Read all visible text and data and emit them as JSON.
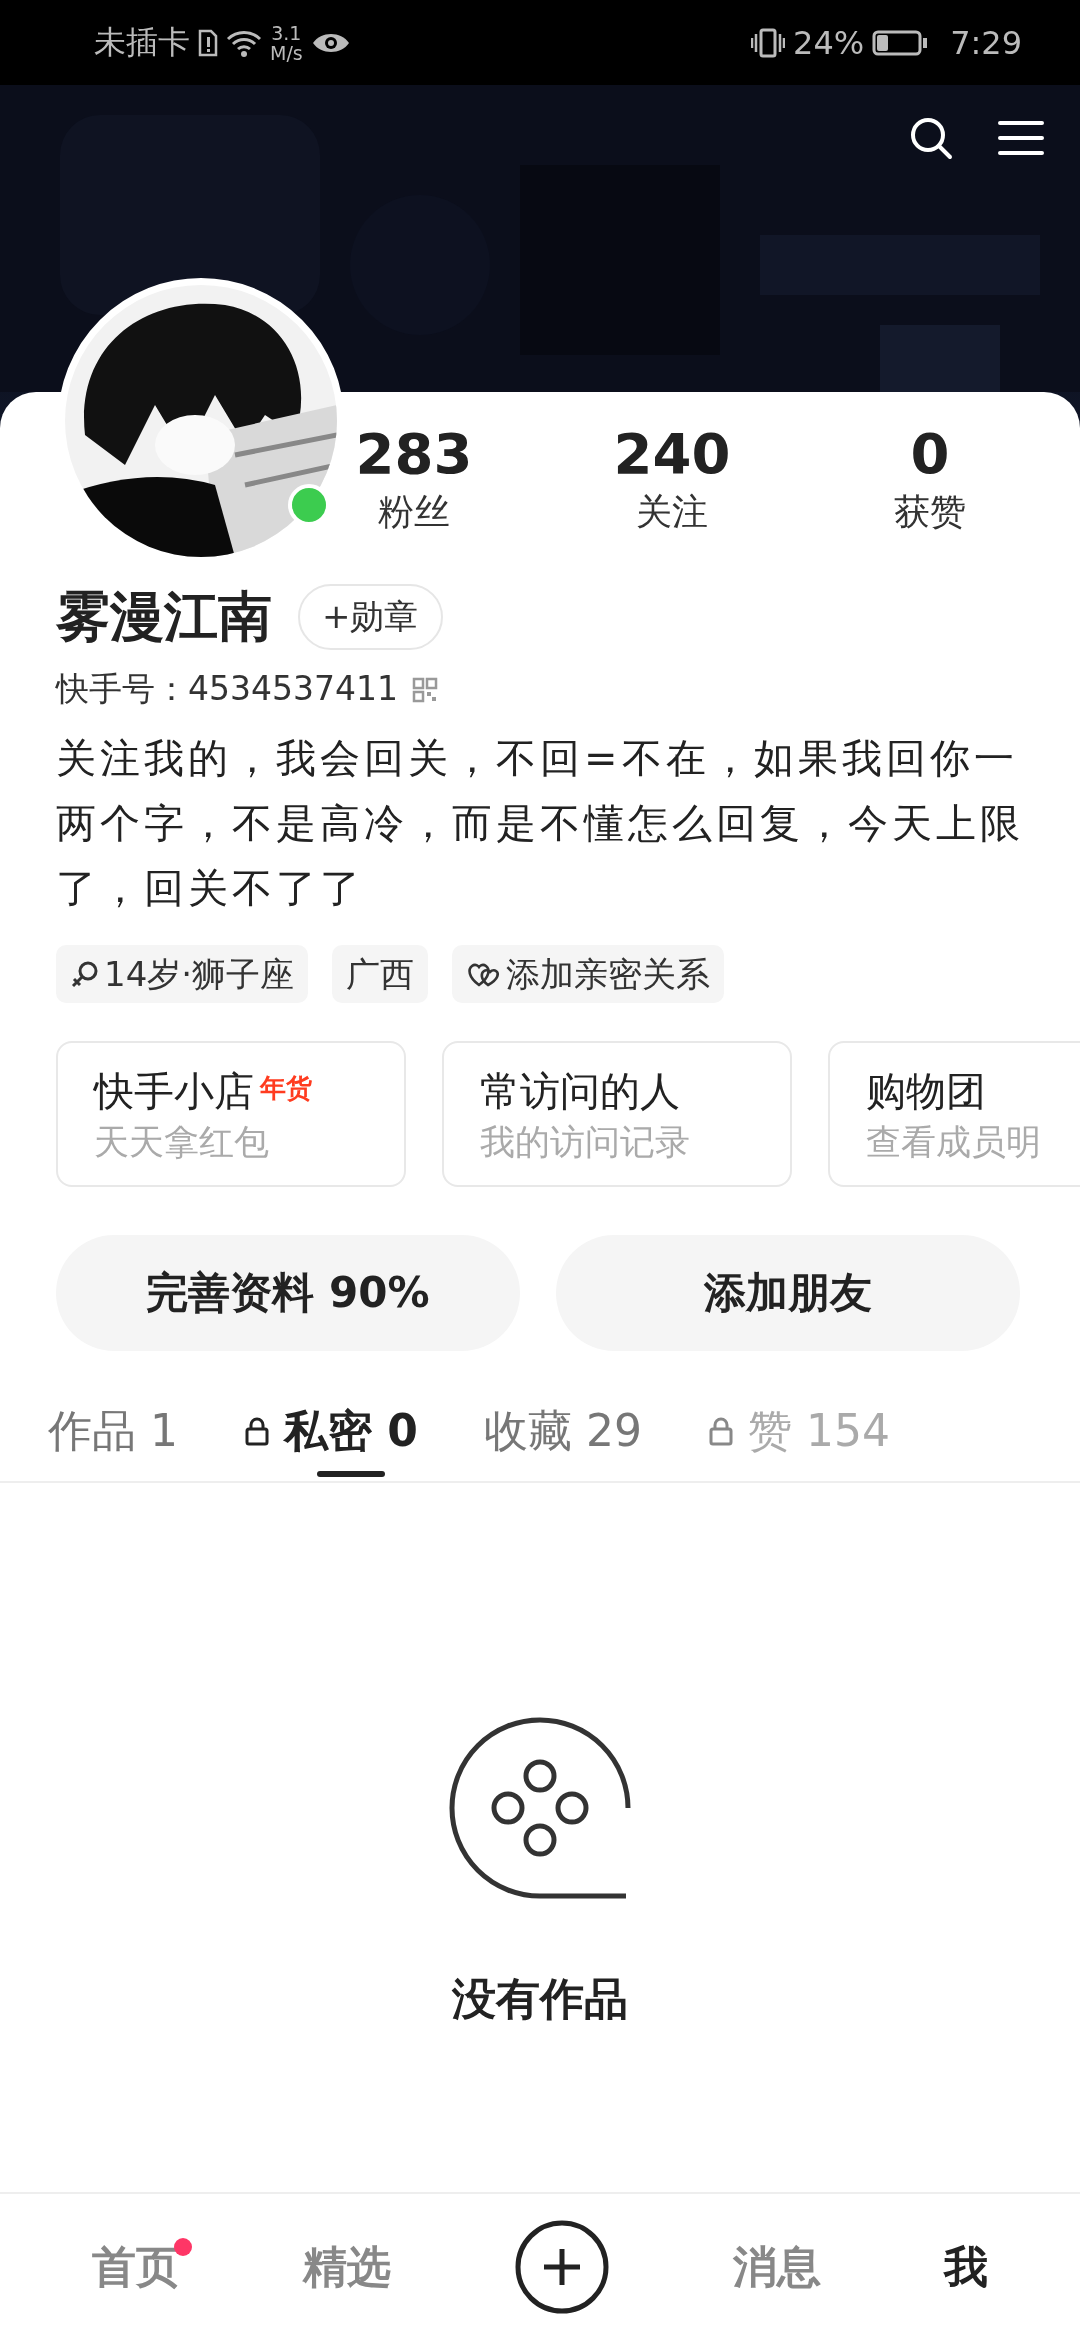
{
  "status_bar": {
    "carrier": "未插卡",
    "net_speed_value": "3.1",
    "net_speed_unit": "M/s",
    "battery": "24%",
    "time": "7:29"
  },
  "profile": {
    "online": true,
    "stats": [
      {
        "value": "283",
        "label": "粉丝"
      },
      {
        "value": "240",
        "label": "关注"
      },
      {
        "value": "0",
        "label": "获赞"
      }
    ],
    "name": "雾漫江南",
    "badge_button": "+勋章",
    "id_label": "快手号：",
    "id": "4534537411",
    "bio": "关注我的，我会回关，不回=不在，如果我回你一两个字，不是高冷，而是不懂怎么回复，今天上限了，回关不了了",
    "tags": [
      {
        "kind": "gender-age",
        "text": "14岁·狮子座"
      },
      {
        "kind": "plain",
        "text": "广西"
      },
      {
        "kind": "relation",
        "text": "添加亲密关系"
      }
    ]
  },
  "cards": [
    {
      "title": "快手小店",
      "tag": "年货",
      "subtitle": "天天拿红包"
    },
    {
      "title": "常访问的人",
      "subtitle": "我的访问记录"
    },
    {
      "title": "购物团",
      "subtitle": "查看成员明"
    }
  ],
  "actions": [
    {
      "label": "完善资料 90%"
    },
    {
      "label": "添加朋友"
    }
  ],
  "tabs": [
    {
      "label": "作品 1",
      "locked": false,
      "selected": false
    },
    {
      "label": "私密 0",
      "locked": true,
      "selected": true
    },
    {
      "label": "收藏 29",
      "locked": false,
      "selected": false
    },
    {
      "label": "赞 154",
      "locked": true,
      "selected": false
    }
  ],
  "empty_state": {
    "text": "没有作品"
  },
  "bottom_nav": [
    {
      "kind": "tab",
      "label": "首页",
      "selected": false,
      "dot": true
    },
    {
      "kind": "tab",
      "label": "精选",
      "selected": false,
      "dot": false
    },
    {
      "kind": "create"
    },
    {
      "kind": "tab",
      "label": "消息",
      "selected": false,
      "dot": false
    },
    {
      "kind": "tab",
      "label": "我",
      "selected": true,
      "dot": false
    }
  ]
}
